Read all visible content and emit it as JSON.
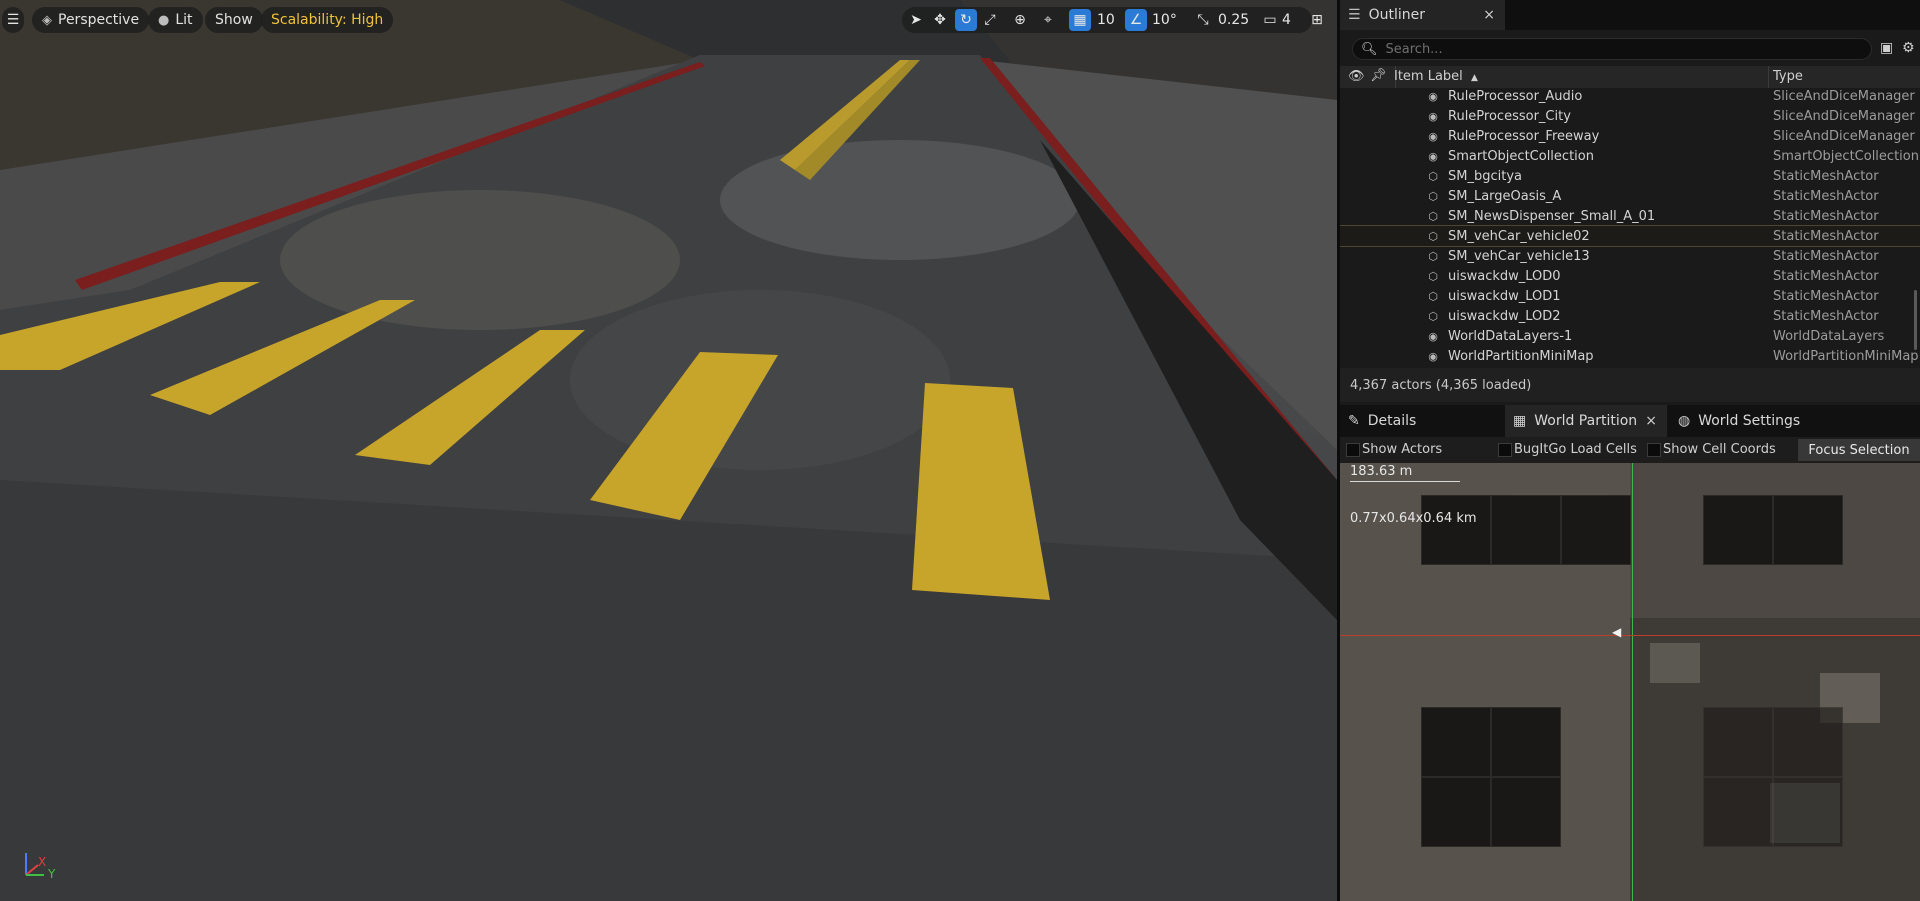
{
  "viewport": {
    "toolbar": {
      "menu_icon": "hamburger-menu-icon",
      "perspective_label": "Perspective",
      "lit_label": "Lit",
      "show_label": "Show",
      "scalability_label": "Scalability: High",
      "grid_snap_value": "10",
      "rotation_snap_value": "10°",
      "scale_snap_value": "0.25",
      "camera_speed_value": "4"
    },
    "axis": {
      "x_label": "X",
      "y_label": "Y"
    }
  },
  "outliner": {
    "tab_title": "Outliner",
    "search_placeholder": "Search...",
    "col_label": "Item Label",
    "col_type": "Type",
    "rows": [
      {
        "label": "RuleProcessor_Audio",
        "type": "SliceAndDiceManager",
        "icon": "sphere-icon"
      },
      {
        "label": "RuleProcessor_City",
        "type": "SliceAndDiceManager",
        "icon": "sphere-icon"
      },
      {
        "label": "RuleProcessor_Freeway",
        "type": "SliceAndDiceManager",
        "icon": "sphere-icon"
      },
      {
        "label": "SmartObjectCollection",
        "type": "SmartObjectCollection",
        "icon": "sphere-icon"
      },
      {
        "label": "SM_bgcitya",
        "type": "StaticMeshActor",
        "icon": "static-mesh-icon"
      },
      {
        "label": "SM_LargeOasis_A",
        "type": "StaticMeshActor",
        "icon": "static-mesh-icon"
      },
      {
        "label": "SM_NewsDispenser_Small_A_01",
        "type": "StaticMeshActor",
        "icon": "static-mesh-icon"
      },
      {
        "label": "SM_vehCar_vehicle02",
        "type": "StaticMeshActor",
        "icon": "static-mesh-icon",
        "selected": true
      },
      {
        "label": "SM_vehCar_vehicle13",
        "type": "StaticMeshActor",
        "icon": "static-mesh-icon"
      },
      {
        "label": "uiswackdw_LOD0",
        "type": "StaticMeshActor",
        "icon": "static-mesh-icon"
      },
      {
        "label": "uiswackdw_LOD1",
        "type": "StaticMeshActor",
        "icon": "static-mesh-icon"
      },
      {
        "label": "uiswackdw_LOD2",
        "type": "StaticMeshActor",
        "icon": "static-mesh-icon"
      },
      {
        "label": "WorldDataLayers-1",
        "type": "WorldDataLayers",
        "icon": "sphere-icon"
      },
      {
        "label": "WorldPartitionMiniMap",
        "type": "WorldPartitionMiniMap",
        "icon": "sphere-icon"
      }
    ],
    "status": "4,367 actors (4,365 loaded)"
  },
  "bottom_panel": {
    "tabs": {
      "details": "Details",
      "world_partition": "World Partition",
      "world_settings": "World Settings"
    },
    "options": {
      "show_actors": "Show Actors",
      "bugitgo_load_cells": "BugItGo Load Cells",
      "show_cell_coords": "Show Cell Coords",
      "focus_selection": "Focus Selection"
    },
    "map": {
      "scale_text": "183.63 m",
      "size_text": "0.77x0.64x0.64 km"
    }
  }
}
